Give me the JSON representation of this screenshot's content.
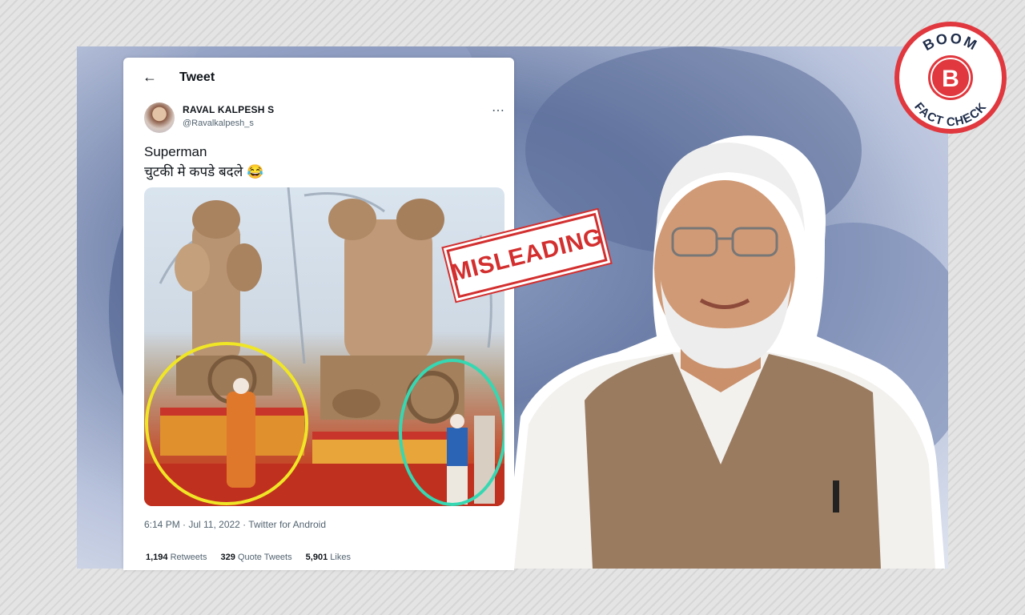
{
  "tweet": {
    "header_title": "Tweet",
    "author_name": "RAVAL KALPESH S",
    "author_handle": "@Ravalkalpesh_s",
    "text_line1": "Superman",
    "text_line2": "चुटकी मे कपडे बदले 😂",
    "meta": "6:14 PM · Jul 11, 2022 · Twitter for Android",
    "stats": {
      "retweets_count": "1,194",
      "retweets_label": "Retweets",
      "quotes_count": "329",
      "quotes_label": "Quote Tweets",
      "likes_count": "5,901",
      "likes_label": "Likes"
    },
    "icons": [
      "back-arrow-icon",
      "more-options-icon"
    ]
  },
  "stamp": {
    "label": "MISLEADING",
    "color": "#d32f2f"
  },
  "badge": {
    "top_text": "BOOM",
    "letter": "B",
    "bottom_text": "FACT CHECK",
    "color": "#e0383e"
  }
}
